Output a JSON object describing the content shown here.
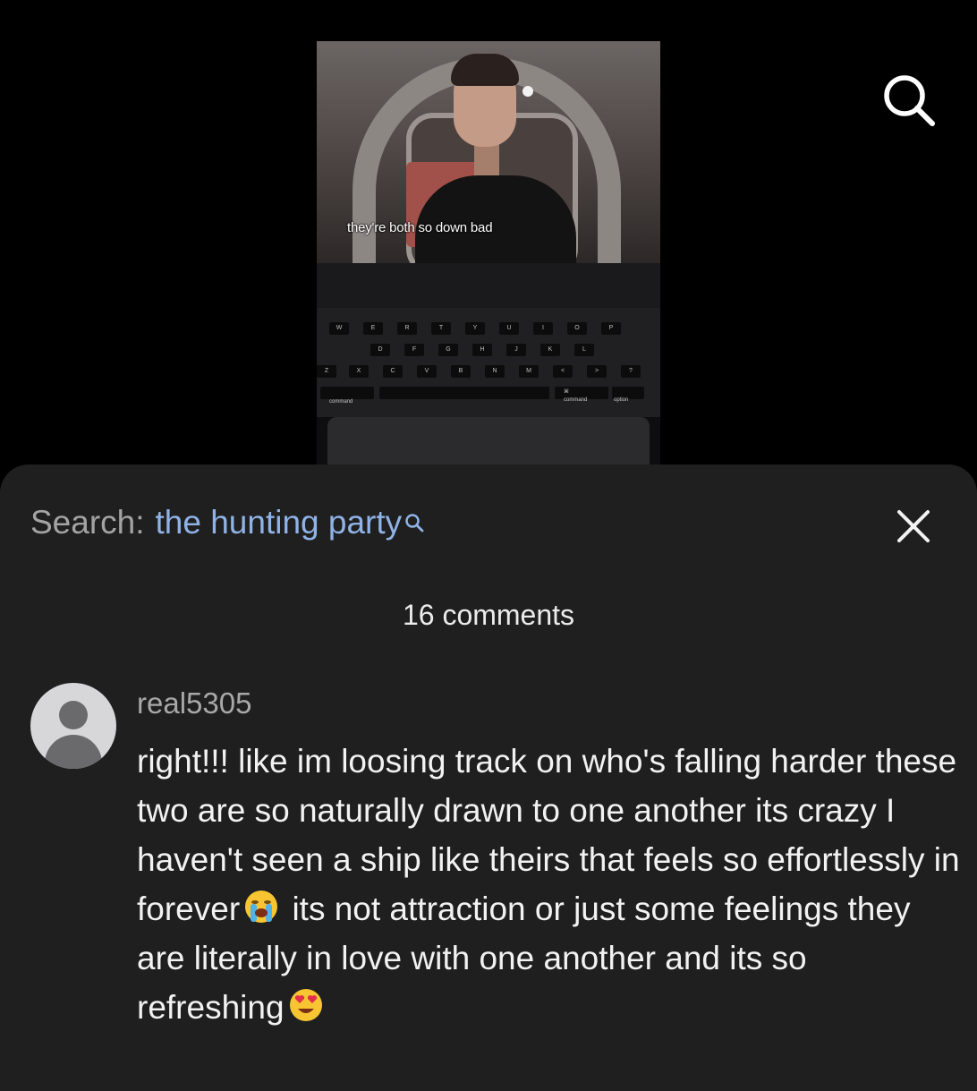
{
  "video": {
    "subtitle": "they're both so down bad",
    "keyboard_labels": {
      "command_left": "command",
      "command_right": "command",
      "option": "option",
      "cmd_symbol": "⌘"
    },
    "key_rows": [
      [
        "W",
        "E",
        "R",
        "T",
        "Y",
        "U",
        "I",
        "O",
        "P"
      ],
      [
        "D",
        "F",
        "G",
        "H",
        "J",
        "K",
        "L"
      ],
      [
        "Z",
        "X",
        "C",
        "V",
        "B",
        "N",
        "M",
        "<",
        ">",
        "?"
      ]
    ]
  },
  "top_bar": {
    "search_icon": "search-icon"
  },
  "sheet": {
    "search_prefix": "Search:",
    "search_query": "the hunting party",
    "search_query_icon": "search-icon",
    "close_icon": "close-icon",
    "comment_count": "16 comments",
    "comments": [
      {
        "username": "real5305",
        "avatar": "default-avatar",
        "text_part1": "right!!! like im loosing track on who's falling harder these two are so naturally drawn to one another its crazy I haven't seen a ship like theirs that feels so effortlessly in forever",
        "emoji1": "loudly-crying-face-emoji",
        "text_part2": "its not attraction or just some feelings they are literally in love with one another and its so refreshing",
        "emoji2": "smiling-face-with-heart-eyes-emoji"
      }
    ]
  },
  "colors": {
    "background": "#000000",
    "sheet_background": "#1f1f1f",
    "search_query": "#8fb3e6",
    "muted_text": "#a3a3a3",
    "primary_text": "#f2f2f2"
  }
}
